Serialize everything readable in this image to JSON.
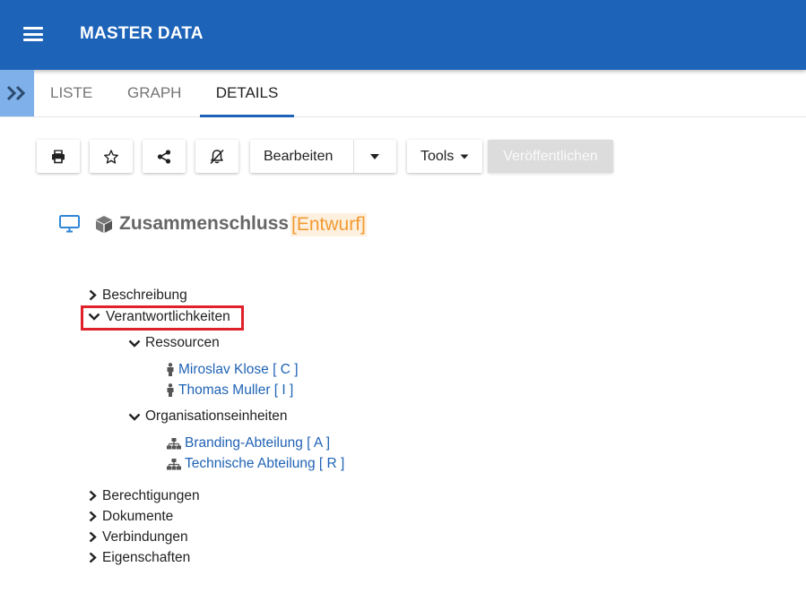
{
  "appbar": {
    "title": "MASTER DATA"
  },
  "tabs": [
    {
      "label": "LISTE"
    },
    {
      "label": "GRAPH"
    },
    {
      "label": "DETAILS",
      "active": true
    }
  ],
  "toolbar": {
    "icons": [
      "print-icon",
      "star-icon",
      "share-icon",
      "bell-off-icon"
    ],
    "edit_label": "Bearbeiten",
    "tools_label": "Tools",
    "publish_label": "Veröffentlichen"
  },
  "object": {
    "title": "Zusammenschluss",
    "status": "[Entwurf]"
  },
  "tree": {
    "beschreibung": "Beschreibung",
    "verantwortlichkeiten": "Verantwortlichkeiten",
    "ressourcen": "Ressourcen",
    "resources": [
      {
        "label": "Miroslav Klose [ C ]"
      },
      {
        "label": "Thomas Muller [ I ]"
      }
    ],
    "organisationseinheiten": "Organisationseinheiten",
    "orgunits": [
      {
        "label": "Branding-Abteilung [ A ]"
      },
      {
        "label": "Technische Abteilung [ R ]"
      }
    ],
    "berechtigungen": "Berechtigungen",
    "dokumente": "Dokumente",
    "verbindungen": "Verbindungen",
    "eigenschaften": "Eigenschaften"
  },
  "colors": {
    "appbar": "#1d63b8",
    "link": "#1f63b5",
    "status": "#f29b33",
    "highlight": "#e0202a"
  }
}
